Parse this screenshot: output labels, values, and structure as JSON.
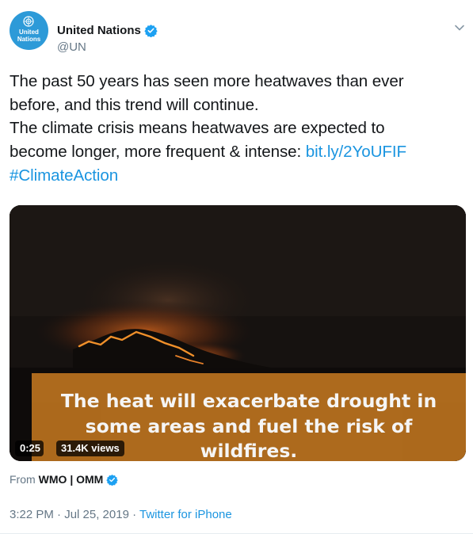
{
  "tweet": {
    "avatar": {
      "text": "United\nNations",
      "icon": "un-emblem-icon"
    },
    "display_name": "United Nations",
    "verified_icon": "verified-badge-icon",
    "handle": "@UN",
    "text_lines": [
      {
        "text": "The past 50 years has seen more heatwaves than ever"
      },
      {
        "text": "before, and this trend will continue."
      },
      {
        "text": "The climate crisis means heatwaves are expected to"
      },
      {
        "text": "become longer, more frequent & intense: ",
        "link": "bit.ly/2YoUFIF"
      },
      {
        "hashtag": "#ClimateAction"
      }
    ],
    "media": {
      "caption_lines": [
        "The heat will exacerbate drought in",
        "some areas and fuel the risk of",
        "wildfires."
      ],
      "duration": "0:25",
      "views": "31.4K views"
    },
    "source": {
      "prefix": "From",
      "name": "WMO | OMM"
    },
    "timestamp": "3:22 PM · Jul 25, 2019",
    "separator": "·",
    "client": "Twitter for iPhone"
  },
  "colors": {
    "link": "#1b95e0",
    "text": "#14171a",
    "muted": "#657786",
    "avatar_bg": "#2d9ad8",
    "caption_bg": "#b46e1e"
  }
}
